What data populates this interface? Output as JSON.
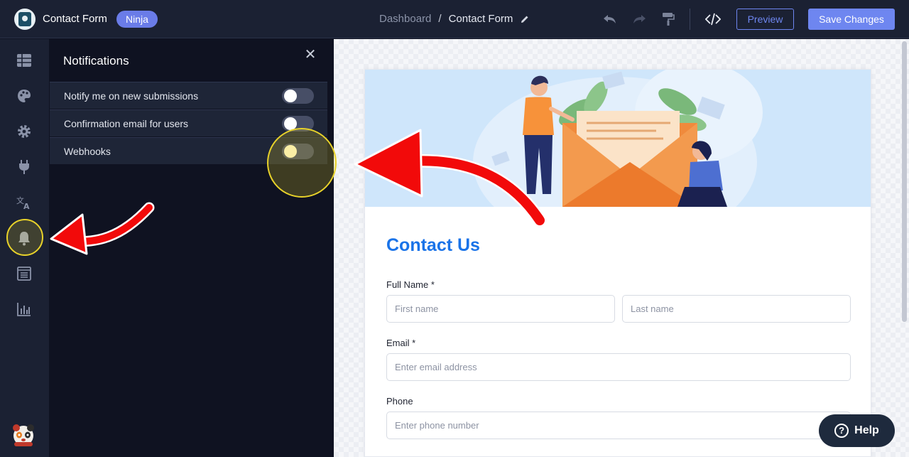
{
  "header": {
    "app_title": "Contact Form",
    "plan_badge": "Ninja",
    "breadcrumb_root": "Dashboard",
    "breadcrumb_separator": "/",
    "breadcrumb_current": "Contact Form",
    "preview_label": "Preview",
    "save_label": "Save Changes",
    "tools": [
      "undo-icon",
      "redo-icon",
      "paint-roller-icon",
      "code-icon"
    ]
  },
  "rail": {
    "items": [
      "grid-icon",
      "palette-icon",
      "gear-icon",
      "plug-icon",
      "translate-icon",
      "bell-icon",
      "list-icon",
      "chart-icon"
    ],
    "active": "bell-icon"
  },
  "panel": {
    "title": "Notifications",
    "close_icon": "close-icon",
    "rows": [
      {
        "label": "Notify me on new submissions",
        "enabled": false
      },
      {
        "label": "Confirmation email for users",
        "enabled": false
      },
      {
        "label": "Webhooks",
        "enabled": false
      }
    ]
  },
  "form": {
    "title": "Contact Us",
    "full_name_label": "Full Name *",
    "first_name_placeholder": "First name",
    "last_name_placeholder": "Last name",
    "email_label": "Email *",
    "email_placeholder": "Enter email address",
    "phone_label": "Phone",
    "phone_placeholder": "Enter phone number"
  },
  "help": {
    "label": "Help"
  },
  "colors": {
    "accent": "#6e86f0",
    "form_title": "#1a73e8",
    "annotation_red": "#f20a0a",
    "highlight_yellow": "#e8d22a"
  }
}
